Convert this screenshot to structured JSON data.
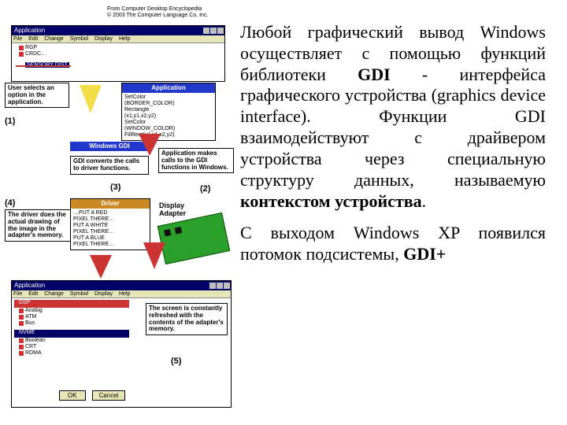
{
  "text": {
    "para1_a": "Любой графический вывод Windows осуществляет с помощью функций библиотеки ",
    "gdi": "GDI",
    "para1_b": " - интерфейса графического устройства (graphics device interface). Функции GDI взаимодействуют с драйвером устройства через специальную структуру данных, называемую ",
    "ctx": "контекстом устройства",
    "period": ".",
    "para2_a": "С выходом Windows XP появился потомок подсистемы, ",
    "gdiplus": "GDI+"
  },
  "diagram": {
    "caption_l1": "From Computer Desktop Encyclopedia",
    "caption_l2": "© 2003 The Computer Language Co. Inc.",
    "top_app": {
      "title": "Application",
      "menu": [
        "File",
        "Edit",
        "Change",
        "Symbol",
        "Display",
        "Help"
      ],
      "items": [
        "RGP",
        "CRDC…",
        "SENSORY DIST"
      ]
    },
    "app_box": {
      "title": "Application",
      "code": [
        "SetColor",
        "(BORDER_COLOR)",
        "Rectangle",
        "(x1,y1,x2,y2)",
        "SetColor",
        "(WINDOW_COLOR)",
        "FillRect(x1,y1,x2,y2)"
      ]
    },
    "gdi_box": {
      "title": "Windows GDI"
    },
    "driver_box": {
      "title": "Driver",
      "code": [
        "…PUT A RED",
        "PIXEL THERE…",
        "PUT A WHITE",
        "PIXEL THERE…",
        "PUT A BLUE",
        "PIXEL THERE…"
      ]
    },
    "display_adapter": "Display Adapter",
    "callouts": {
      "c1": "User selects an option in the application.",
      "c2": "Application makes calls to the GDI functions in Windows.",
      "c3": "GDI converts the calls to driver functions.",
      "c4": "The driver does the actual drawing of the image in the adapter's memory.",
      "c5": "The screen is constantly refreshed with the contents of the adapter's memory."
    },
    "labels": {
      "l1": "(1)",
      "l2": "(2)",
      "l3": "(3)",
      "l4": "(4)",
      "l5": "(5)"
    },
    "bottom_app": {
      "title": "Application",
      "menu": [
        "File",
        "Edit",
        "Change",
        "Symbol",
        "Display",
        "Help"
      ],
      "group1_title": "DSP",
      "group1_items": [
        "Analog",
        "ATM",
        "Bus"
      ],
      "group2_title": "NVME",
      "group2_items": [
        "Boolean",
        "CRT",
        "RDMA"
      ],
      "buttons": {
        "ok": "OK",
        "cancel": "Cancel"
      }
    }
  }
}
